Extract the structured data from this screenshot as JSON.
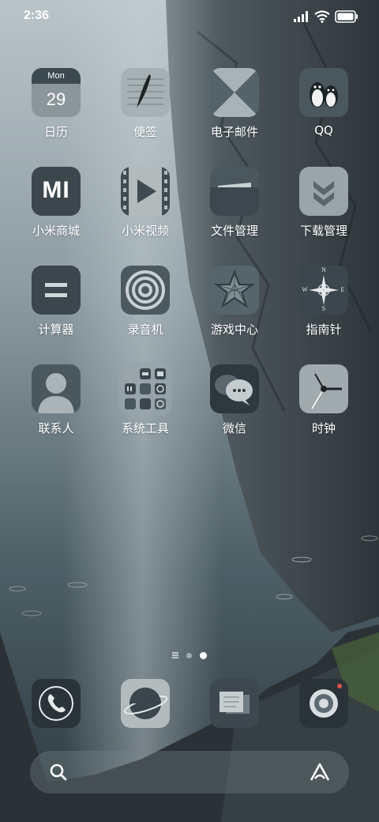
{
  "status_bar": {
    "time": "2:36",
    "icons": [
      "signal-icon",
      "wifi-icon",
      "battery-icon"
    ]
  },
  "apps": [
    {
      "id": "calendar",
      "label": "日历",
      "icon": "calendar-icon",
      "day_of_week": "Mon",
      "date": "29"
    },
    {
      "id": "notes",
      "label": "便签",
      "icon": "notes-icon"
    },
    {
      "id": "email",
      "label": "电子邮件",
      "icon": "email-icon"
    },
    {
      "id": "qq",
      "label": "QQ",
      "icon": "qq-icon"
    },
    {
      "id": "mi-store",
      "label": "小米商城",
      "icon": "mi-store-icon",
      "logo_text": "MI"
    },
    {
      "id": "mi-video",
      "label": "小米视频",
      "icon": "video-icon"
    },
    {
      "id": "file-manager",
      "label": "文件管理",
      "icon": "folder-icon"
    },
    {
      "id": "downloads",
      "label": "下载管理",
      "icon": "download-icon"
    },
    {
      "id": "calculator",
      "label": "计算器",
      "icon": "calculator-icon"
    },
    {
      "id": "recorder",
      "label": "录音机",
      "icon": "recorder-icon"
    },
    {
      "id": "game-center",
      "label": "游戏中心",
      "icon": "game-star-icon"
    },
    {
      "id": "compass",
      "label": "指南针",
      "icon": "compass-icon",
      "directions": [
        "N",
        "E",
        "S",
        "W"
      ]
    },
    {
      "id": "contacts",
      "label": "联系人",
      "icon": "contacts-icon"
    },
    {
      "id": "system-tools",
      "label": "系统工具",
      "icon": "folder-grid-icon"
    },
    {
      "id": "wechat",
      "label": "微信",
      "icon": "wechat-icon"
    },
    {
      "id": "clock",
      "label": "时钟",
      "icon": "clock-icon"
    }
  ],
  "page_indicator": {
    "pages": 2,
    "current": 2
  },
  "dock": [
    {
      "id": "phone",
      "icon": "phone-icon"
    },
    {
      "id": "browser",
      "icon": "browser-planet-icon"
    },
    {
      "id": "messages",
      "icon": "messages-icon"
    },
    {
      "id": "camera",
      "icon": "camera-icon"
    }
  ],
  "search": {
    "icon": "search-icon",
    "assistant_icon": "assistant-icon"
  }
}
